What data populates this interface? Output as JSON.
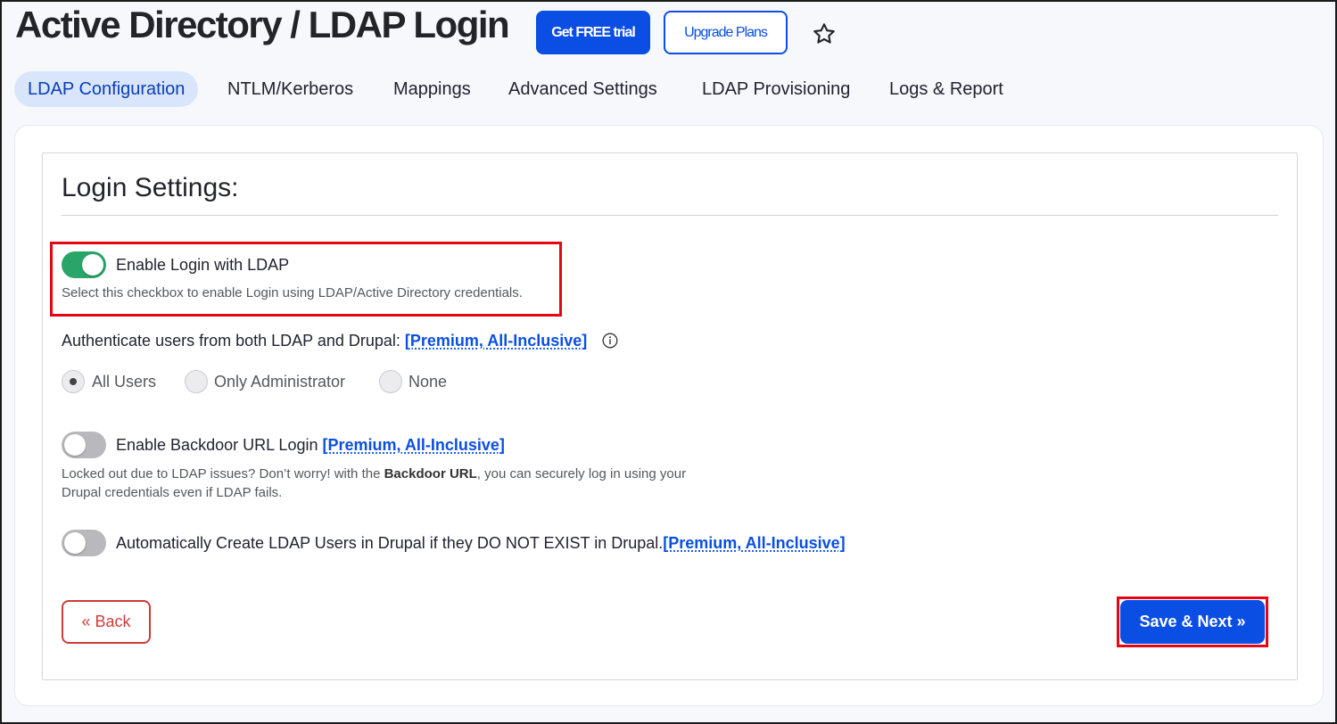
{
  "header": {
    "title": "Active Directory / LDAP Login",
    "trial_label": "Get FREE trial",
    "upgrade_label": "Upgrade Plans"
  },
  "tabs": [
    {
      "label": "LDAP Configuration",
      "active": true
    },
    {
      "label": "NTLM/Kerberos"
    },
    {
      "label": "Mappings"
    },
    {
      "label": "Advanced Settings"
    },
    {
      "label": "LDAP Provisioning"
    },
    {
      "label": "Logs & Report"
    }
  ],
  "section": {
    "title": "Login Settings:"
  },
  "enable_login": {
    "label": "Enable Login with LDAP",
    "enabled": true,
    "description": "Select this checkbox to enable Login using LDAP/Active Directory credentials."
  },
  "authenticate": {
    "label": "Authenticate users from both LDAP and Drupal:",
    "premium_link": "[Premium, All-Inclusive]",
    "options": [
      {
        "label": "All Users",
        "selected": true
      },
      {
        "label": "Only Administrator"
      },
      {
        "label": "None"
      }
    ]
  },
  "backdoor": {
    "label": "Enable Backdoor URL Login",
    "premium_link": "[Premium, All-Inclusive]",
    "enabled": false,
    "description_before": "Locked out due to LDAP issues? Don’t worry! with the ",
    "description_bold": "Backdoor URL",
    "description_after": ", you can securely log in using your",
    "description_line2": "Drupal credentials even if LDAP fails."
  },
  "auto_create": {
    "label": "Automatically Create LDAP Users in Drupal if they DO NOT EXIST in Drupal.",
    "premium_link": "[Premium, All-Inclusive]",
    "enabled": false
  },
  "footer": {
    "back_label": "« Back",
    "save_label": "Save & Next »"
  },
  "colors": {
    "primary": "#0a4ee4",
    "toggle_on": "#2aa56a",
    "highlight": "#e30613",
    "back": "#cf3b3b"
  }
}
